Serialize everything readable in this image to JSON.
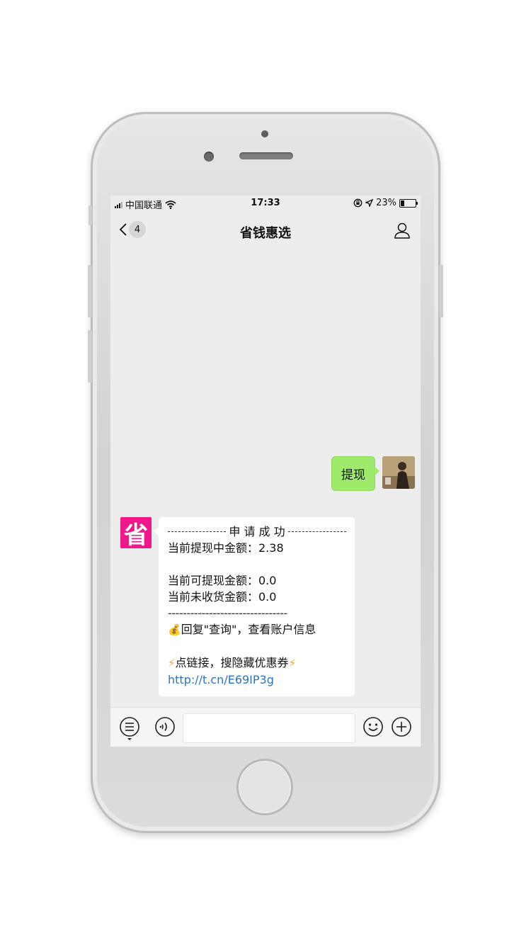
{
  "status_bar": {
    "carrier": "中国联通",
    "time": "17:33",
    "battery_percent": "23%",
    "battery_level": 0.23
  },
  "nav": {
    "back_count": "4",
    "title": "省钱惠选"
  },
  "messages": {
    "outgoing": {
      "text": "提现"
    },
    "incoming": {
      "avatar_text": "省",
      "title": "申 请 成 功",
      "line_pending": "当前提现中金额：2.38",
      "line_available": "当前可提现金额：0.0",
      "line_unreceived": "当前未收货金额：0.0",
      "separator": "--------------------------------",
      "reply_hint": "回复\"查询\"，查看账户信息",
      "link_hint": "点链接，搜隐藏优惠券",
      "link": "http://t.cn/E69IP3g"
    }
  },
  "input_bar": {
    "input_value": ""
  },
  "colors": {
    "chat_bg": "#ededed",
    "outgoing_bubble": "#9eea6a",
    "bot_avatar": "#f0178a",
    "link": "#2a73c8"
  },
  "icons": [
    "wifi-icon",
    "lock-rotation-icon",
    "location-arrow-icon",
    "battery-icon",
    "back-chevron-icon",
    "profile-icon",
    "menu-list-icon",
    "voice-icon",
    "emoji-icon",
    "plus-icon"
  ]
}
